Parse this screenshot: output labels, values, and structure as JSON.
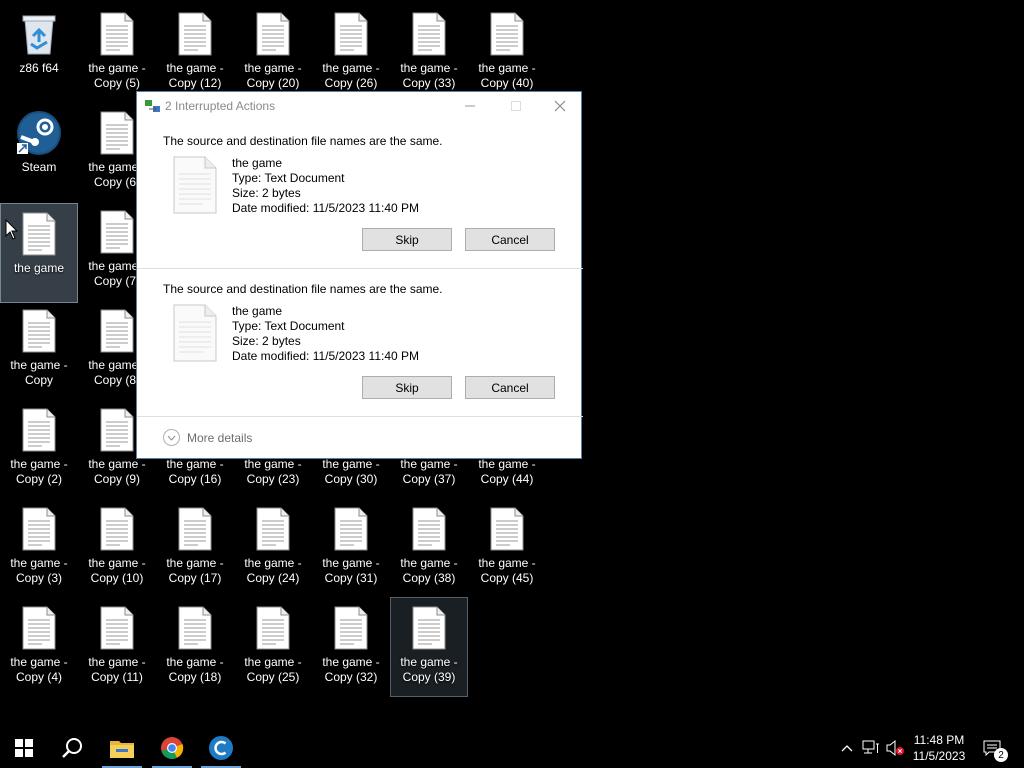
{
  "desktop": {
    "recycle_bin": {
      "label": "z86 f64",
      "icon": "recycle-bin-icon"
    },
    "steam": {
      "label": "Steam",
      "icon": "steam-icon"
    },
    "the_game": {
      "label": "the game",
      "icon": "text-document-icon"
    },
    "copies": [
      {
        "label": "the game -\nCopy (5)"
      },
      {
        "label": "the game -\nCopy (12)"
      },
      {
        "label": "the game -\nCopy (20)"
      },
      {
        "label": "the game -\nCopy (26)"
      },
      {
        "label": "the game -\nCopy (33)"
      },
      {
        "label": "the game -\nCopy (40)"
      },
      {
        "label": "the game -\nCopy (6)"
      },
      {
        "label": "the game -\nCopy (7)"
      },
      {
        "label": "the game -\nCopy"
      },
      {
        "label": "the game -\nCopy (8)"
      },
      {
        "label": "the game -\nCopy (2)"
      },
      {
        "label": "the game -\nCopy (9)"
      },
      {
        "label": "the game -\nCopy (16)"
      },
      {
        "label": "the game -\nCopy (23)"
      },
      {
        "label": "the game -\nCopy (30)"
      },
      {
        "label": "the game -\nCopy (37)"
      },
      {
        "label": "the game -\nCopy (44)"
      },
      {
        "label": "the game -\nCopy (3)"
      },
      {
        "label": "the game -\nCopy (10)"
      },
      {
        "label": "the game -\nCopy (17)"
      },
      {
        "label": "the game -\nCopy (24)"
      },
      {
        "label": "the game -\nCopy (31)"
      },
      {
        "label": "the game -\nCopy (38)"
      },
      {
        "label": "the game -\nCopy (45)"
      },
      {
        "label": "the game -\nCopy (4)"
      },
      {
        "label": "the game -\nCopy (11)"
      },
      {
        "label": "the game -\nCopy (18)"
      },
      {
        "label": "the game -\nCopy (25)"
      },
      {
        "label": "the game -\nCopy (32)"
      },
      {
        "label": "the game -\nCopy (39)"
      }
    ]
  },
  "dialog": {
    "title": "2 Interrupted Actions",
    "conflicts": [
      {
        "message": "The source and destination file names are the same.",
        "file_name": "the game",
        "type": "Type: Text Document",
        "size": "Size: 2 bytes",
        "modified": "Date modified: 11/5/2023 11:40 PM",
        "skip_label": "Skip",
        "cancel_label": "Cancel"
      },
      {
        "message": "The source and destination file names are the same.",
        "file_name": "the game",
        "type": "Type: Text Document",
        "size": "Size: 2 bytes",
        "modified": "Date modified: 11/5/2023 11:40 PM",
        "skip_label": "Skip",
        "cancel_label": "Cancel"
      }
    ],
    "more_details": "More details"
  },
  "taskbar": {
    "clock_time": "11:48 PM",
    "clock_date": "11/5/2023",
    "notification_count": "2",
    "pinned": [
      "start-icon",
      "search-icon",
      "file-explorer-icon",
      "chrome-icon",
      "ccleaner-icon"
    ],
    "accent": "#6aa3d8"
  }
}
